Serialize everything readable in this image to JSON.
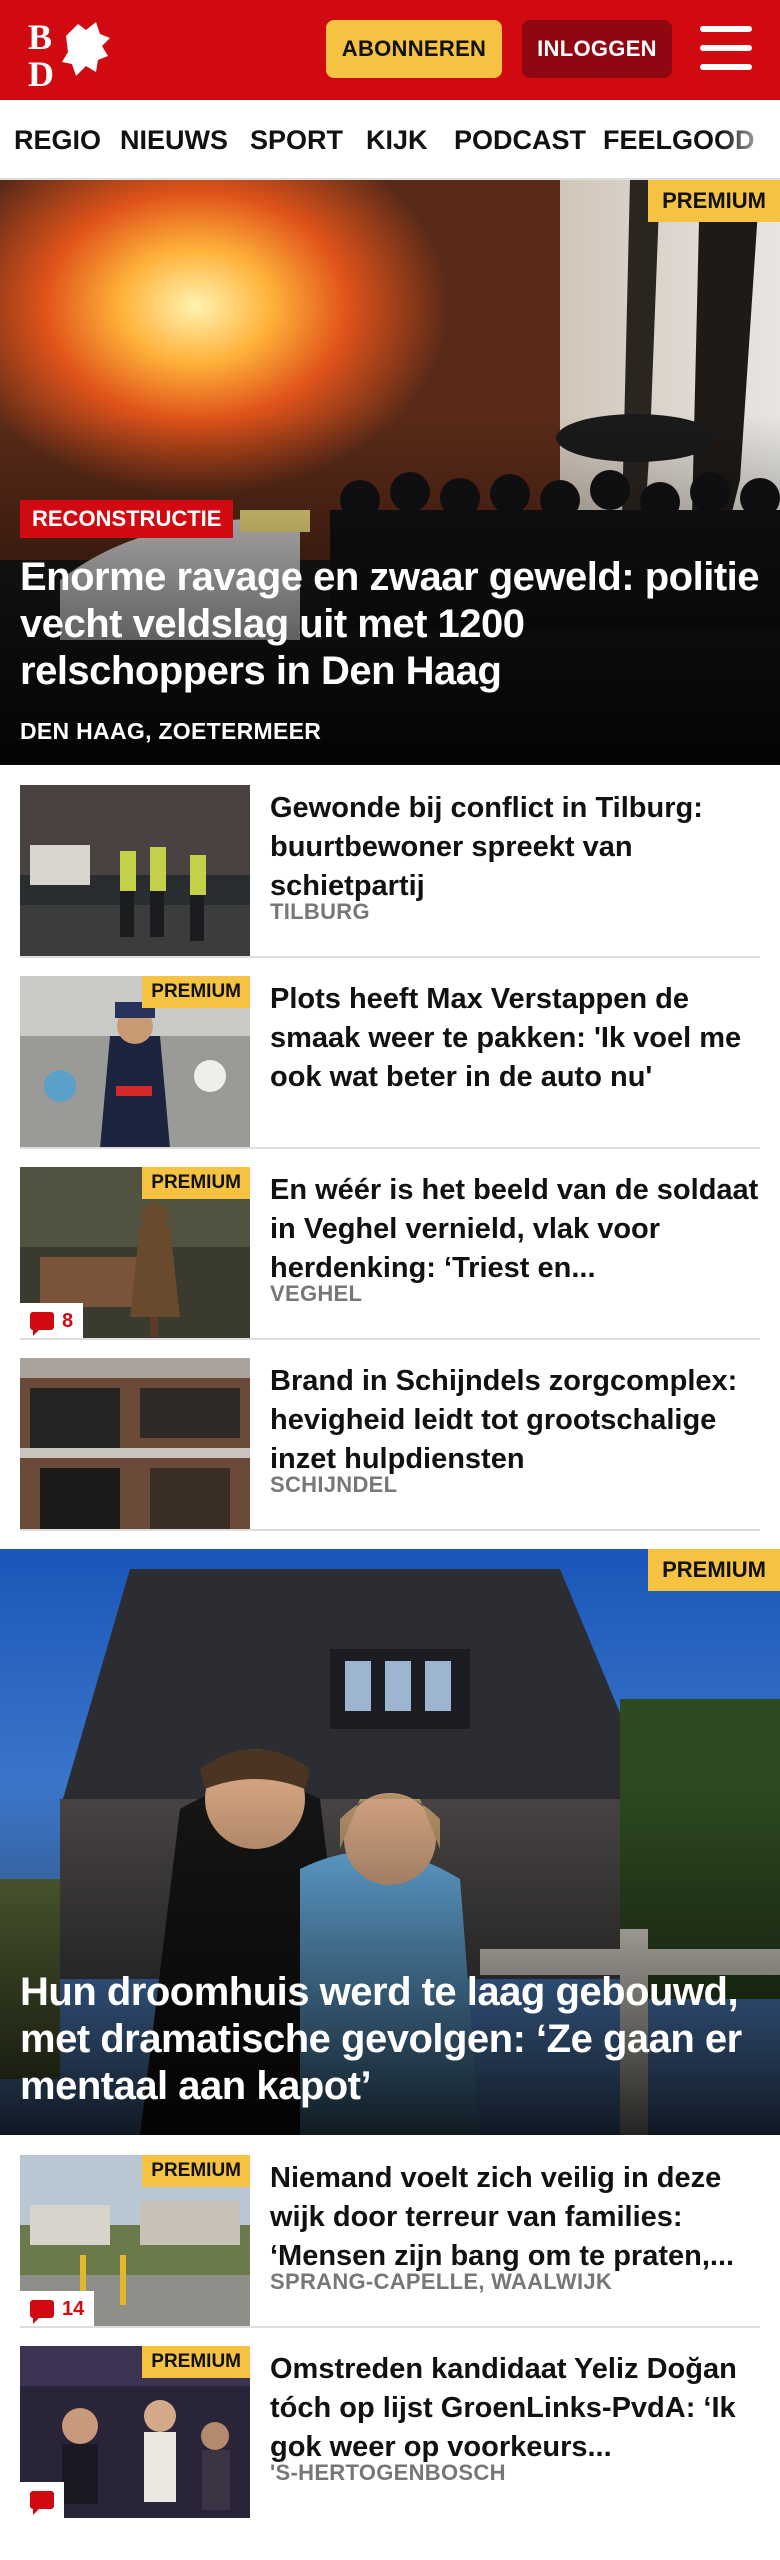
{
  "header": {
    "logo_text": "BD",
    "subscribe_label": "ABONNEREN",
    "login_label": "INLOGGEN",
    "brand_color": "#d10a11"
  },
  "nav": {
    "items": [
      "REGIO",
      "NIEUWS",
      "SPORT",
      "KIJK",
      "PODCAST",
      "FEELGOOD"
    ]
  },
  "hero": {
    "premium": "PREMIUM",
    "tag": "RECONSTRUCTIE",
    "title": "Enorme ravage en zwaar geweld: politie vecht veldslag uit met 1200 relschoppers in Den Haag",
    "location": "DEN HAAG, ZOETERMEER"
  },
  "articles": [
    {
      "title": "Gewonde bij conflict in Tilburg: buurtbewoner spreekt van schietpartij",
      "location": "TILBURG",
      "premium": "",
      "comments": ""
    },
    {
      "title": "Plots heeft Max Verstappen de smaak weer te pakken: 'Ik voel me ook wat beter in de auto nu'",
      "location": "",
      "premium": "PREMIUM",
      "comments": ""
    },
    {
      "title": "En wéér is het beeld van de soldaat in Veghel vernield, vlak voor herdenking: ‘Triest en...",
      "location": "VEGHEL",
      "premium": "PREMIUM",
      "comments": "8"
    },
    {
      "title": "Brand in Schijndels zorgcomplex: hevigheid leidt tot grootschalige inzet hulpdiensten",
      "location": "SCHIJNDEL",
      "premium": "",
      "comments": ""
    }
  ],
  "hero2": {
    "premium": "PREMIUM",
    "title": "Hun droomhuis werd te laag gebouwd, met dramatische gevolgen: ‘Ze gaan er mentaal aan kapot’"
  },
  "articles2": [
    {
      "title": "Niemand voelt zich veilig in deze wijk door terreur van families: ‘Mensen zijn bang om te praten,...",
      "location": "SPRANG-CAPELLE, WAALWIJK",
      "premium": "PREMIUM",
      "comments": "14"
    },
    {
      "title": "Omstreden kandidaat Yeliz Doğan tóch op lijst GroenLinks-PvdA: ‘Ik gok weer op voorkeurs...",
      "location": "'S-HERTOGENBOSCH",
      "premium": "PREMIUM",
      "comments": ""
    }
  ]
}
